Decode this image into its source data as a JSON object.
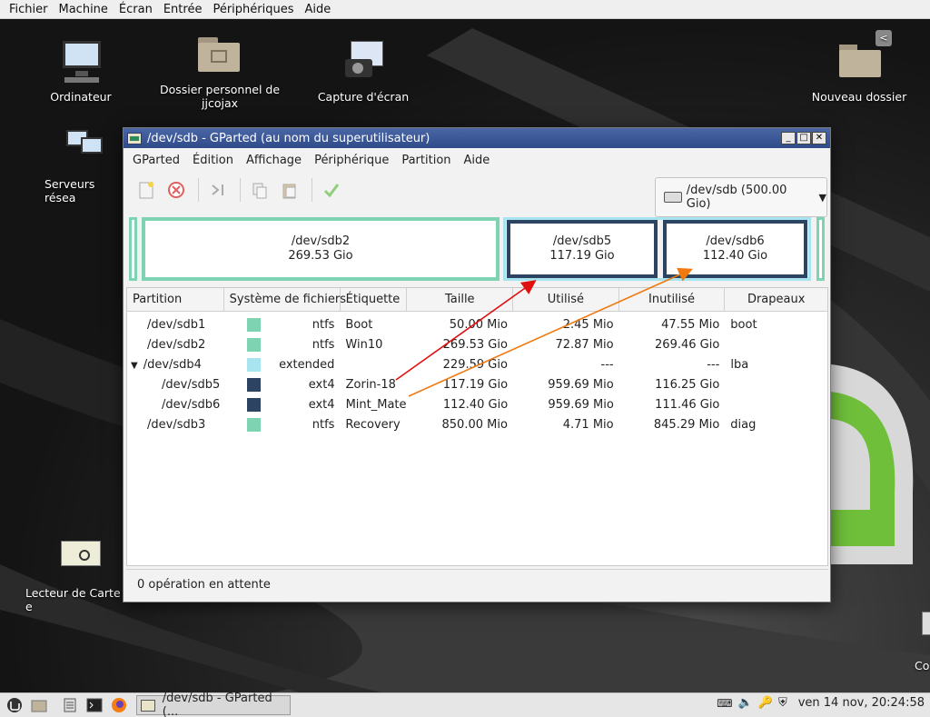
{
  "host_menu": [
    "Fichier",
    "Machine",
    "Écran",
    "Entrée",
    "Périphériques",
    "Aide"
  ],
  "desktop_icons": {
    "computer": "Ordinateur",
    "home": "Dossier personnel de jjcojax",
    "screenshot": "Capture d'écran",
    "new_folder": "Nouveau dossier",
    "network": "Serveurs résea",
    "card_reader": "Lecteur de Carte e",
    "trash": "Co"
  },
  "window": {
    "title": "/dev/sdb - GParted (au nom du superutilisateur)",
    "menu": [
      "GParted",
      "Édition",
      "Affichage",
      "Périphérique",
      "Partition",
      "Aide"
    ],
    "device_selector": "/dev/sdb (500.00 Gio)",
    "status": "0 opération en attente"
  },
  "partition_map": {
    "sdb2": {
      "name": "/dev/sdb2",
      "size": "269.53 Gio"
    },
    "sdb5": {
      "name": "/dev/sdb5",
      "size": "117.19 Gio"
    },
    "sdb6": {
      "name": "/dev/sdb6",
      "size": "112.40 Gio"
    }
  },
  "table": {
    "headers": [
      "Partition",
      "Système de fichiers",
      "Étiquette",
      "Taille",
      "Utilisé",
      "Inutilisé",
      "Drapeaux"
    ],
    "rows": [
      {
        "partition": "/dev/sdb1",
        "fs": "ntfs",
        "label": "Boot",
        "size": "50.00 Mio",
        "used": "2.45 Mio",
        "unused": "47.55 Mio",
        "flags": "boot",
        "color": "#7dd3b2"
      },
      {
        "partition": "/dev/sdb2",
        "fs": "ntfs",
        "label": "Win10",
        "size": "269.53 Gio",
        "used": "72.87 Mio",
        "unused": "269.46 Gio",
        "flags": "",
        "color": "#7dd3b2"
      },
      {
        "partition": "/dev/sdb4",
        "fs": "extended",
        "label": "",
        "size": "229.59 Gio",
        "used": "---",
        "unused": "---",
        "flags": "lba",
        "color": "#a8e4f0"
      },
      {
        "partition": "/dev/sdb5",
        "fs": "ext4",
        "label": "Zorin-18",
        "size": "117.19 Gio",
        "used": "959.69 Mio",
        "unused": "116.25 Gio",
        "flags": "",
        "color": "#2c4461"
      },
      {
        "partition": "/dev/sdb6",
        "fs": "ext4",
        "label": "Mint_Mate",
        "size": "112.40 Gio",
        "used": "959.69 Mio",
        "unused": "111.46 Gio",
        "flags": "",
        "color": "#2c4461"
      },
      {
        "partition": "/dev/sdb3",
        "fs": "ntfs",
        "label": "Recovery",
        "size": "850.00 Mio",
        "used": "4.71 Mio",
        "unused": "845.29 Mio",
        "flags": "diag",
        "color": "#7dd3b2"
      }
    ]
  },
  "taskbar": {
    "task": "/dev/sdb - GParted (...",
    "clock": "ven 14 nov, 20:24:58"
  },
  "colors": {
    "ntfs": "#7dd3b2",
    "ext4": "#2c4461",
    "extended": "#a8e4f0",
    "arrow_red": "#e01010",
    "arrow_orange": "#f07a10"
  }
}
